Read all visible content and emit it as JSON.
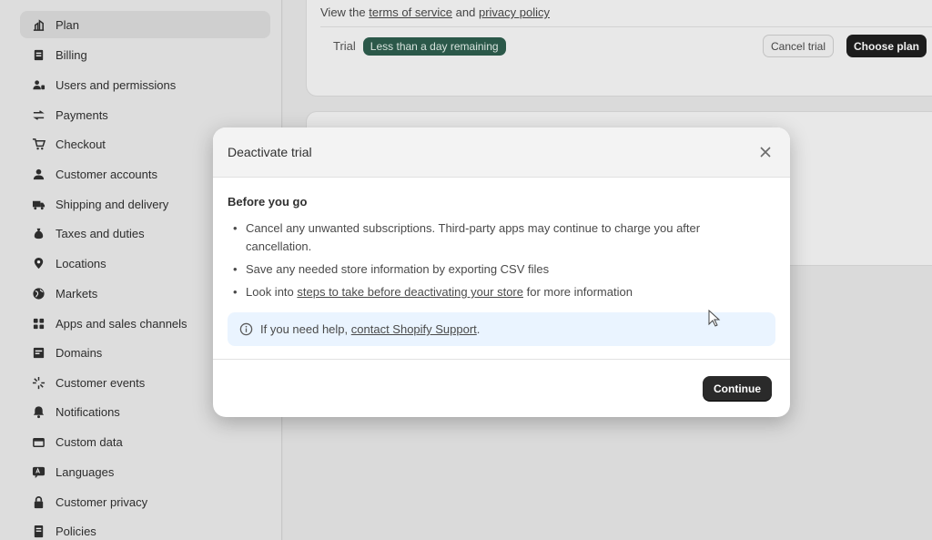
{
  "sidebar": {
    "items": [
      {
        "label": "Plan",
        "icon": "plan-icon",
        "active": true
      },
      {
        "label": "Billing",
        "icon": "billing-icon"
      },
      {
        "label": "Users and permissions",
        "icon": "users-icon"
      },
      {
        "label": "Payments",
        "icon": "payments-icon"
      },
      {
        "label": "Checkout",
        "icon": "cart-icon"
      },
      {
        "label": "Customer accounts",
        "icon": "person-icon"
      },
      {
        "label": "Shipping and delivery",
        "icon": "truck-icon"
      },
      {
        "label": "Taxes and duties",
        "icon": "tax-icon"
      },
      {
        "label": "Locations",
        "icon": "location-icon"
      },
      {
        "label": "Markets",
        "icon": "globe-icon"
      },
      {
        "label": "Apps and sales channels",
        "icon": "apps-icon"
      },
      {
        "label": "Domains",
        "icon": "domains-icon"
      },
      {
        "label": "Customer events",
        "icon": "events-icon"
      },
      {
        "label": "Notifications",
        "icon": "bell-icon"
      },
      {
        "label": "Custom data",
        "icon": "custom-data-icon"
      },
      {
        "label": "Languages",
        "icon": "languages-icon"
      },
      {
        "label": "Customer privacy",
        "icon": "lock-icon"
      },
      {
        "label": "Policies",
        "icon": "policies-icon"
      }
    ]
  },
  "plan_card": {
    "view_prefix": "View the",
    "terms_link": "terms of service",
    "and_text": "and",
    "privacy_link": "privacy policy",
    "trial_label": "Trial",
    "trial_badge": "Less than a day remaining",
    "cancel_trial_label": "Cancel trial",
    "choose_plan_label": "Choose plan"
  },
  "modal": {
    "title": "Deactivate trial",
    "heading": "Before you go",
    "bullet_1": "Cancel any unwanted subscriptions. Third-party apps may continue to charge you after cancellation.",
    "bullet_2": "Save any needed store information by exporting CSV files",
    "bullet_3_prefix": "Look into",
    "bullet_3_link": "steps to take before deactivating your store",
    "bullet_3_suffix": "for more information",
    "info_prefix": "If you need help,",
    "info_link": "contact Shopify Support",
    "info_suffix": ".",
    "continue_label": "Continue"
  },
  "colors": {
    "badge_bg": "#2e5e4e",
    "primary_button": "#2a2a2a",
    "info_banner_bg": "#eaf4ff"
  }
}
